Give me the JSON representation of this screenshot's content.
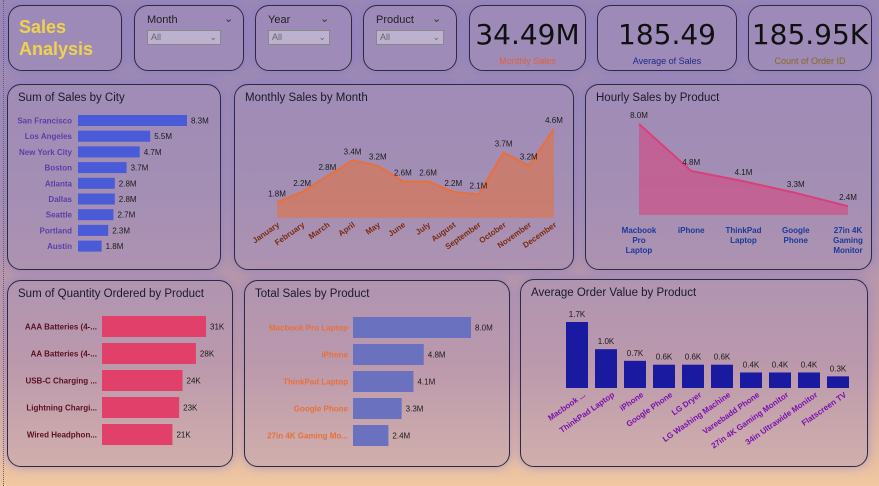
{
  "title": "Sales\nAnalysis",
  "slicers": [
    {
      "label": "Month",
      "value": "All"
    },
    {
      "label": "Year",
      "value": "All"
    },
    {
      "label": "Product",
      "value": "All"
    }
  ],
  "kpis": [
    {
      "value": "34.49M",
      "label": "Monthly Sales",
      "color": "#e0603a"
    },
    {
      "value": "185.49",
      "label": "Average of Sales",
      "color": "#1c2a8a"
    },
    {
      "value": "185.95K",
      "label": "Count of Order ID",
      "color": "#8a6a1a"
    }
  ],
  "chart_data": [
    {
      "type": "bar",
      "orientation": "horizontal",
      "title": "Sum of Sales by City",
      "categories": [
        "San Francisco",
        "Los Angeles",
        "New York City",
        "Boston",
        "Atlanta",
        "Dallas",
        "Seattle",
        "Portland",
        "Austin"
      ],
      "values": [
        8.3,
        5.5,
        4.7,
        3.7,
        2.8,
        2.8,
        2.7,
        2.3,
        1.8
      ],
      "labels": [
        "8.3M",
        "5.5M",
        "4.7M",
        "3.7M",
        "2.8M",
        "2.8M",
        "2.7M",
        "2.3M",
        "1.8M"
      ],
      "color": "#4a5bd8",
      "label_color": "#5a3fa8"
    },
    {
      "type": "area",
      "title": "Monthly Sales by Month",
      "categories": [
        "January",
        "February",
        "March",
        "April",
        "May",
        "June",
        "July",
        "August",
        "September",
        "October",
        "November",
        "December"
      ],
      "values": [
        1.8,
        2.2,
        2.8,
        3.4,
        3.2,
        2.6,
        2.6,
        2.2,
        2.1,
        3.7,
        3.2,
        4.6
      ],
      "labels": [
        "1.8M",
        "2.2M",
        "2.8M",
        "3.4M",
        "3.2M",
        "2.6M",
        "2.6M",
        "2.2M",
        "2.1M",
        "3.7M",
        "3.2M",
        "4.6M"
      ],
      "color": "#e8703a",
      "label_color": "#7a2a10"
    },
    {
      "type": "area",
      "title": "Hourly Sales by Product",
      "categories": [
        "Macbook Pro Laptop",
        "iPhone",
        "ThinkPad Laptop",
        "Google Phone",
        "27in 4K Gaming Monitor"
      ],
      "values": [
        8.0,
        4.8,
        4.1,
        3.3,
        2.4
      ],
      "labels": [
        "8.0M",
        "4.8M",
        "4.1M",
        "3.3M",
        "2.4M"
      ],
      "color": "#d8407a",
      "label_color": "#1a3a9a"
    },
    {
      "type": "bar",
      "orientation": "horizontal",
      "title": "Sum of Quantity Ordered by Product",
      "categories": [
        "AAA Batteries (4-...",
        "AA Batteries (4-...",
        "USB-C Charging ...",
        "Lightning Chargi...",
        "Wired Headphon..."
      ],
      "values": [
        31,
        28,
        24,
        23,
        21
      ],
      "labels": [
        "31K",
        "28K",
        "24K",
        "23K",
        "21K"
      ],
      "color": "#e0406a",
      "label_color": "#5a1020"
    },
    {
      "type": "bar",
      "orientation": "horizontal",
      "title": "Total Sales by Product",
      "categories": [
        "Macbook Pro Laptop",
        "iPhone",
        "ThinkPad Laptop",
        "Google Phone",
        "27in 4K Gaming Mo..."
      ],
      "values": [
        8.0,
        4.8,
        4.1,
        3.3,
        2.4
      ],
      "labels": [
        "8.0M",
        "4.8M",
        "4.1M",
        "3.3M",
        "2.4M"
      ],
      "color": "#6a72c0",
      "label_color": "#e8703a"
    },
    {
      "type": "bar",
      "orientation": "vertical",
      "title": "Average Order Value by Product",
      "categories": [
        "Macbook ...",
        "ThinkPad Laptop",
        "iPhone",
        "Google Phone",
        "LG Dryer",
        "LG Washing Machine",
        "Vareebadd Phone",
        "27in 4K Gaming Monitor",
        "34in Ultrawide Monitor",
        "Flatscreen TV"
      ],
      "values": [
        1.7,
        1.0,
        0.7,
        0.6,
        0.6,
        0.6,
        0.4,
        0.4,
        0.4,
        0.3
      ],
      "labels": [
        "1.7K",
        "1.0K",
        "0.7K",
        "0.6K",
        "0.6K",
        "0.6K",
        "0.4K",
        "0.4K",
        "0.4K",
        "0.3K"
      ],
      "color": "#1a1aa0",
      "label_color": "#7a10b0"
    }
  ]
}
